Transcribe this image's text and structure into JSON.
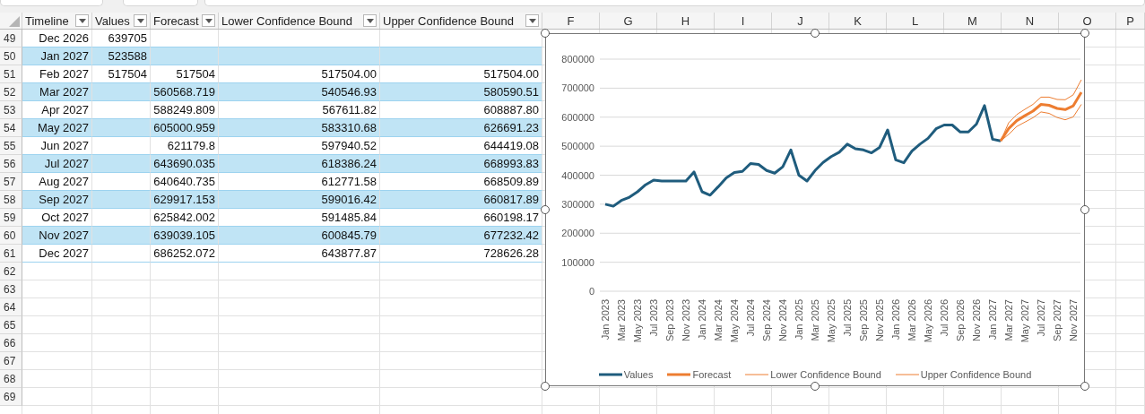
{
  "column_letters": [
    "F",
    "G",
    "H",
    "I",
    "J",
    "K",
    "L",
    "M",
    "N",
    "O",
    "P"
  ],
  "row_numbers": [
    "49",
    "50",
    "51",
    "52",
    "53",
    "54",
    "55",
    "56",
    "57",
    "58",
    "59",
    "60",
    "61",
    "62",
    "63",
    "64",
    "65",
    "66",
    "67",
    "68",
    "69"
  ],
  "table": {
    "columns": [
      "Timeline",
      "Values",
      "Forecast",
      "Lower Confidence Bound",
      "Upper Confidence Bound"
    ],
    "rows": [
      {
        "timeline": "Dec 2026",
        "values": "639705"
      },
      {
        "timeline": "Jan 2027",
        "values": "523588"
      },
      {
        "timeline": "Feb 2027",
        "values": "517504",
        "forecast": "517504",
        "lower": "517504.00",
        "upper": "517504.00"
      },
      {
        "timeline": "Mar 2027",
        "forecast": "560568.719",
        "lower": "540546.93",
        "upper": "580590.51"
      },
      {
        "timeline": "Apr 2027",
        "forecast": "588249.809",
        "lower": "567611.82",
        "upper": "608887.80"
      },
      {
        "timeline": "May 2027",
        "forecast": "605000.959",
        "lower": "583310.68",
        "upper": "626691.23"
      },
      {
        "timeline": "Jun 2027",
        "forecast": "621179.8",
        "lower": "597940.52",
        "upper": "644419.08"
      },
      {
        "timeline": "Jul 2027",
        "forecast": "643690.035",
        "lower": "618386.24",
        "upper": "668993.83"
      },
      {
        "timeline": "Aug 2027",
        "forecast": "640640.735",
        "lower": "612771.58",
        "upper": "668509.89"
      },
      {
        "timeline": "Sep 2027",
        "forecast": "629917.153",
        "lower": "599016.42",
        "upper": "660817.89"
      },
      {
        "timeline": "Oct 2027",
        "forecast": "625842.002",
        "lower": "591485.84",
        "upper": "660198.17"
      },
      {
        "timeline": "Nov 2027",
        "forecast": "639039.105",
        "lower": "600845.79",
        "upper": "677232.42"
      },
      {
        "timeline": "Dec 2027",
        "forecast": "686252.072",
        "lower": "643877.87",
        "upper": "728626.28"
      }
    ]
  },
  "chart": {
    "chart_data": {
      "type": "line",
      "grid": true,
      "legend": "bottom",
      "categories": [
        "Jan 2023",
        null,
        "Mar 2023",
        null,
        "May 2023",
        null,
        "Jul 2023",
        null,
        "Sep 2023",
        null,
        "Nov 2023",
        null,
        "Jan 2024",
        null,
        "Mar 2024",
        null,
        "May 2024",
        null,
        "Jul 2024",
        null,
        "Sep 2024",
        null,
        "Nov 2024",
        null,
        "Jan 2025",
        null,
        "Mar 2025",
        null,
        "May 2025",
        null,
        "Jul 2025",
        null,
        "Sep 2025",
        null,
        "Nov 2025",
        null,
        "Jan 2026",
        null,
        "Mar 2026",
        null,
        "May 2026",
        null,
        "Jul 2026",
        null,
        "Sep 2026",
        null,
        "Nov 2026",
        null,
        "Jan 2027",
        null,
        "Mar 2027",
        null,
        "May 2027",
        null,
        "Jul 2027",
        null,
        "Sep 2027",
        null,
        "Nov 2027",
        null
      ],
      "ylim": [
        0,
        800000
      ],
      "yticks": [
        0,
        100000,
        200000,
        300000,
        400000,
        500000,
        600000,
        700000,
        800000
      ],
      "series": [
        {
          "name": "Values",
          "color": "#1f5c7d",
          "values": [
            300000,
            293000,
            313000,
            324000,
            343000,
            367000,
            383000,
            380000,
            380000,
            380000,
            380000,
            411000,
            343000,
            331000,
            360000,
            391000,
            409000,
            413000,
            440000,
            437000,
            416000,
            407000,
            429000,
            487000,
            400000,
            380000,
            416000,
            444000,
            464000,
            479000,
            507000,
            491000,
            487000,
            477000,
            496000,
            556000,
            453000,
            443000,
            483000,
            507000,
            527000,
            560000,
            573000,
            573000,
            549000,
            549000,
            576000,
            640000,
            524000,
            518000,
            null,
            null,
            null,
            null,
            null,
            null,
            null,
            null,
            null,
            null
          ]
        },
        {
          "name": "Forecast",
          "color": "#ed7d31",
          "values": [
            null,
            null,
            null,
            null,
            null,
            null,
            null,
            null,
            null,
            null,
            null,
            null,
            null,
            null,
            null,
            null,
            null,
            null,
            null,
            null,
            null,
            null,
            null,
            null,
            null,
            null,
            null,
            null,
            null,
            null,
            null,
            null,
            null,
            null,
            null,
            null,
            null,
            null,
            null,
            null,
            null,
            null,
            null,
            null,
            null,
            null,
            null,
            null,
            null,
            518000,
            561000,
            588000,
            605000,
            621000,
            644000,
            641000,
            630000,
            626000,
            639000,
            686000
          ]
        },
        {
          "name": "Lower Confidence Bound",
          "color": "#ed7d31",
          "values": [
            null,
            null,
            null,
            null,
            null,
            null,
            null,
            null,
            null,
            null,
            null,
            null,
            null,
            null,
            null,
            null,
            null,
            null,
            null,
            null,
            null,
            null,
            null,
            null,
            null,
            null,
            null,
            null,
            null,
            null,
            null,
            null,
            null,
            null,
            null,
            null,
            null,
            null,
            null,
            null,
            null,
            null,
            null,
            null,
            null,
            null,
            null,
            null,
            null,
            518000,
            541000,
            568000,
            583000,
            598000,
            618000,
            613000,
            599000,
            591000,
            601000,
            644000
          ]
        },
        {
          "name": "Upper Confidence Bound",
          "color": "#ed7d31",
          "values": [
            null,
            null,
            null,
            null,
            null,
            null,
            null,
            null,
            null,
            null,
            null,
            null,
            null,
            null,
            null,
            null,
            null,
            null,
            null,
            null,
            null,
            null,
            null,
            null,
            null,
            null,
            null,
            null,
            null,
            null,
            null,
            null,
            null,
            null,
            null,
            null,
            null,
            null,
            null,
            null,
            null,
            null,
            null,
            null,
            null,
            null,
            null,
            null,
            null,
            518000,
            581000,
            609000,
            627000,
            644000,
            669000,
            669000,
            661000,
            660000,
            677000,
            729000
          ]
        }
      ]
    }
  }
}
